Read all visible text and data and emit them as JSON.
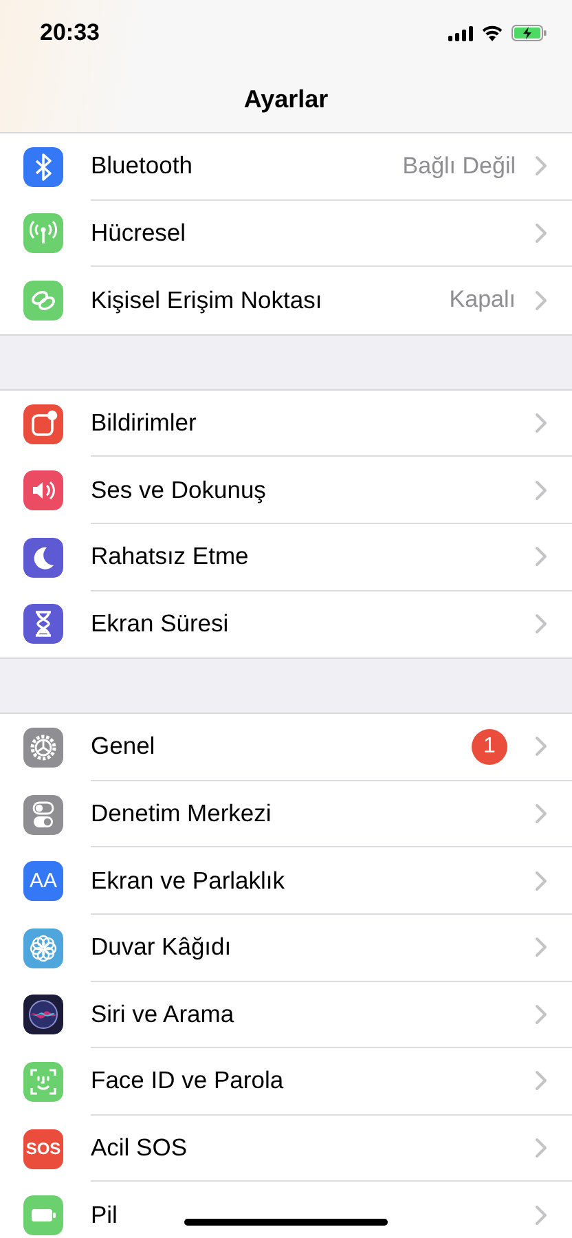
{
  "status_bar": {
    "time": "20:33"
  },
  "nav": {
    "title": "Ayarlar"
  },
  "groups": [
    {
      "rows": [
        {
          "label": "Bluetooth",
          "value": "Bağlı Değil",
          "color": "#3478f6"
        },
        {
          "label": "Hücresel",
          "color": "#6bd16f"
        },
        {
          "label": "Kişisel Erişim Noktası",
          "value": "Kapalı",
          "color": "#6bd16f"
        }
      ]
    },
    {
      "rows": [
        {
          "label": "Bildirimler",
          "color": "#eb4d3d"
        },
        {
          "label": "Ses ve Dokunuş",
          "color": "#eb4b63"
        },
        {
          "label": "Rahatsız Etme",
          "color": "#5d5ad3"
        },
        {
          "label": "Ekran Süresi",
          "color": "#5d5ad3"
        }
      ]
    },
    {
      "rows": [
        {
          "label": "Genel",
          "badge": "1",
          "color": "#8e8e93"
        },
        {
          "label": "Denetim Merkezi",
          "color": "#8e8e93"
        },
        {
          "label": "Ekran ve Parlaklık",
          "icon_text": "AA",
          "color": "#3478f6"
        },
        {
          "label": "Duvar Kâğıdı",
          "color": "#4fa6dc"
        },
        {
          "label": "Siri ve Arama",
          "color": "#1c1b3a"
        },
        {
          "label": "Face ID ve Parola",
          "color": "#6bd16f"
        },
        {
          "label": "Acil SOS",
          "icon_text": "SOS",
          "color": "#eb4d3d"
        },
        {
          "label": "Pil",
          "color": "#6bd16f"
        }
      ]
    }
  ]
}
